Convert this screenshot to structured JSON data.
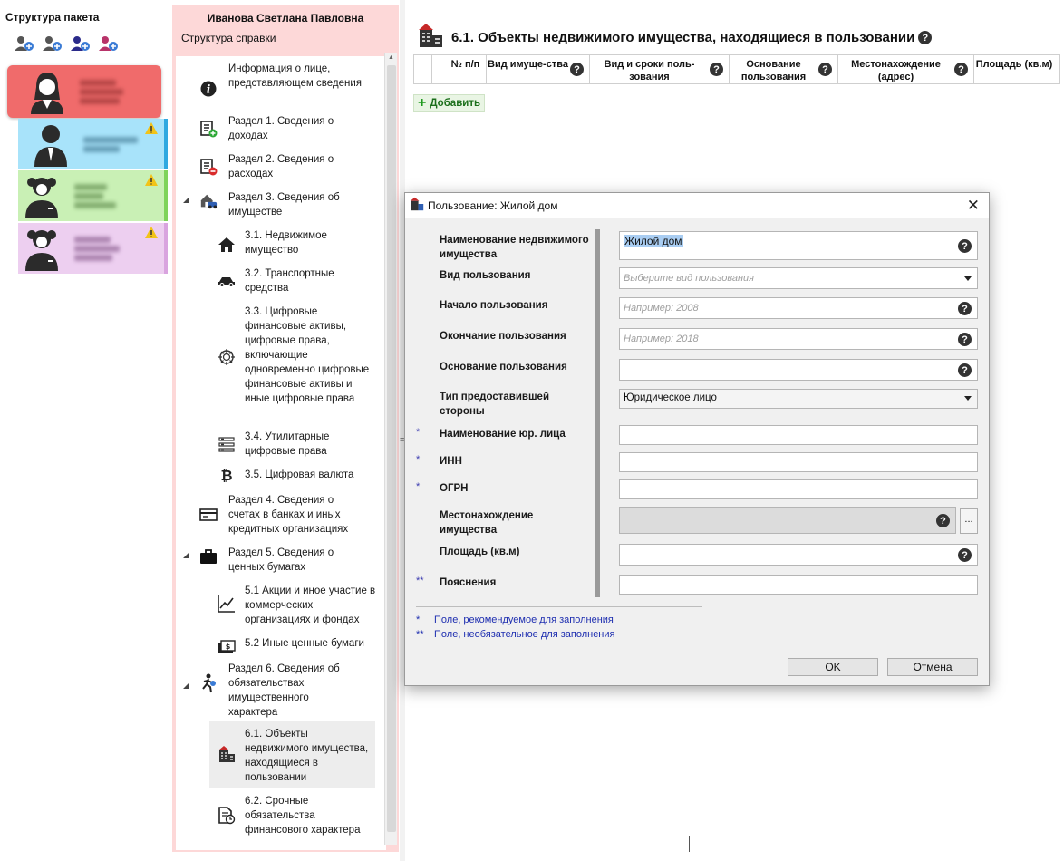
{
  "package": {
    "title": "Структура пакета",
    "tools": [
      "add-spouse-icon",
      "add-child-icon",
      "add-relative-icon",
      "add-person-icon"
    ],
    "persons": [
      {
        "color": "#f06b6b",
        "avatar": "woman",
        "warning": false
      },
      {
        "color": "#a8e3fa",
        "avatar": "man",
        "warning": true
      },
      {
        "color": "#c9f0b5",
        "avatar": "girl",
        "warning": true
      },
      {
        "color": "#edcff0",
        "avatar": "girl",
        "warning": true
      }
    ]
  },
  "structure": {
    "owner": "Иванова Светлана Павловна",
    "subtitle": "Структура справки",
    "items": [
      {
        "label": "Информация о лице, представляющем сведения",
        "icon": "info-icon"
      },
      {
        "label": "Раздел 1. Сведения о доходах",
        "icon": "income-icon"
      },
      {
        "label": "Раздел 2. Сведения о расходах",
        "icon": "expenses-icon"
      },
      {
        "label": "Раздел 3. Сведения об имуществе",
        "icon": "property-icon"
      },
      {
        "label": "3.1. Недвижимое имущество",
        "icon": "house-icon"
      },
      {
        "label": "3.2. Транспортные средства",
        "icon": "car-icon"
      },
      {
        "label": "3.3. Цифровые финансовые активы, цифровые права, включающие одновременно цифровые финансовые активы и иные цифровые права",
        "icon": "digital-assets-icon"
      },
      {
        "label": "3.4. Утилитарные цифровые права",
        "icon": "utility-rights-icon"
      },
      {
        "label": "3.5. Цифровая валюта",
        "icon": "bitcoin-icon"
      },
      {
        "label": "Раздел 4. Сведения о счетах в банках и иных кредитных организациях",
        "icon": "bank-card-icon"
      },
      {
        "label": "Раздел 5. Сведения о ценных бумагах",
        "icon": "briefcase-icon"
      },
      {
        "label": "5.1 Акции и иное участие в коммерческих организациях и фондах",
        "icon": "stock-chart-icon"
      },
      {
        "label": "5.2 Иные ценные бумаги",
        "icon": "securities-icon"
      },
      {
        "label": "Раздел 6. Сведения об обязательствах имущественного характера",
        "icon": "obligations-icon"
      },
      {
        "label": "6.1. Объекты недвижимого имущества, находящиеся в пользовании",
        "icon": "building-icon"
      },
      {
        "label": "6.2. Срочные обязательства финансового характера",
        "icon": "document-clock-icon"
      }
    ]
  },
  "main": {
    "title": "6.1. Объекты недвижимого имущества, находящиеся в пользовании",
    "columns": [
      "№ п/п",
      "Вид имуще-ства",
      "Вид и сроки поль-зования",
      "Основание пользования",
      "Местонахождение (адрес)",
      "Площадь (кв.м)"
    ],
    "add_label": "Добавить"
  },
  "dialog": {
    "title": "Пользование: Жилой дом",
    "fields": {
      "name": {
        "label": "Наименование недвижимого имущества",
        "value": "Жилой дом"
      },
      "usage_type": {
        "label": "Вид пользования",
        "placeholder": "Выберите вид пользования"
      },
      "start": {
        "label": "Начало пользования",
        "placeholder": "Например: 2008"
      },
      "end": {
        "label": "Окончание пользования",
        "placeholder": "Например: 2018"
      },
      "basis": {
        "label": "Основание пользования"
      },
      "provider_type": {
        "label": "Тип предоставившей стороны",
        "value": "Юридическое лицо"
      },
      "org_name": {
        "label": "Наименование юр. лица",
        "mark": "*"
      },
      "inn": {
        "label": "ИНН",
        "mark": "*"
      },
      "ogrn": {
        "label": "ОГРН",
        "mark": "*"
      },
      "location": {
        "label": "Местонахождение имущества",
        "browse": "..."
      },
      "area": {
        "label": "Площадь (кв.м)"
      },
      "notes": {
        "label": "Пояснения",
        "mark": "**"
      }
    },
    "legend": [
      {
        "mark": "*",
        "text": "Поле, рекомендуемое для заполнения"
      },
      {
        "mark": "**",
        "text": "Поле, необязательное для заполнения"
      }
    ],
    "ok": "OK",
    "cancel": "Отмена"
  }
}
